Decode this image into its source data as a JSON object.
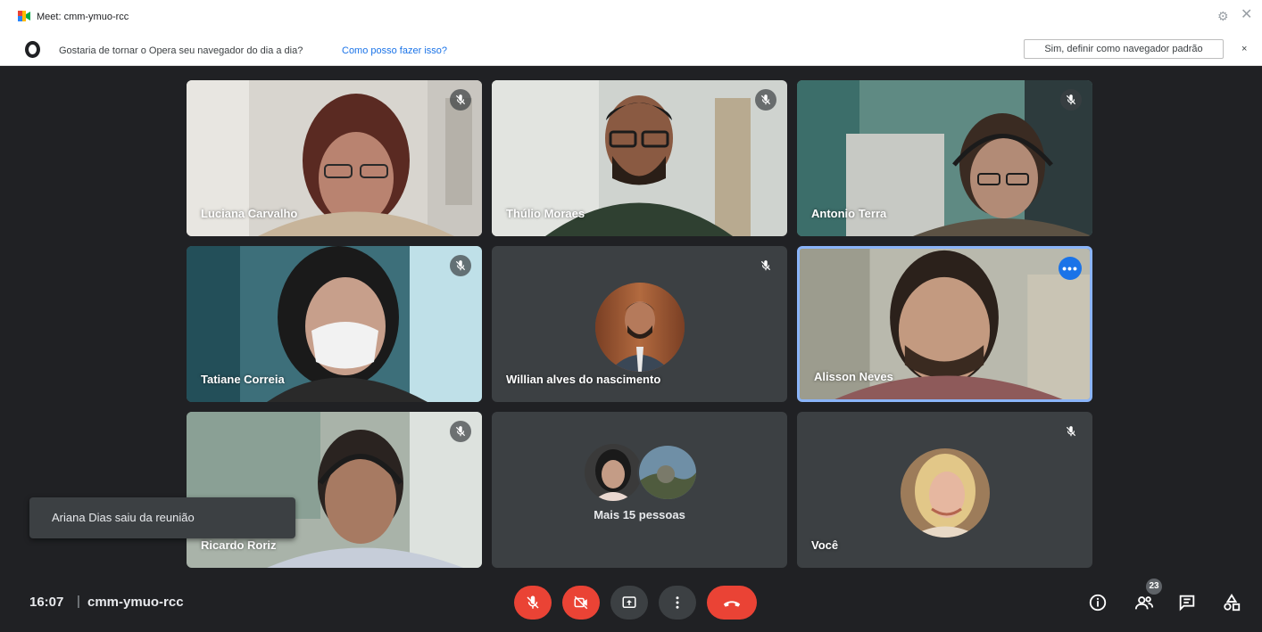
{
  "window": {
    "title": "Meet: cmm-ymuo-rcc"
  },
  "opera_bar": {
    "question": "Gostaria de tornar o Opera seu navegador do dia a dia?",
    "link": "Como posso fazer isso?",
    "button": "Sim, definir como navegador padrão",
    "close": "×"
  },
  "participants": [
    {
      "name": "Luciana Carvalho",
      "muted": true
    },
    {
      "name": "Thúlio Moraes",
      "muted": true
    },
    {
      "name": "Antonio Terra",
      "muted": true
    },
    {
      "name": "Tatiane Correia",
      "muted": true
    },
    {
      "name": "Willian alves do nascimento",
      "muted": true
    },
    {
      "name": "Alisson Neves",
      "muted": false,
      "speaking": true
    },
    {
      "name": "Ricardo Roriz",
      "muted": true
    },
    {
      "name": "Mais 15 pessoas"
    },
    {
      "name": "Você",
      "muted": true
    }
  ],
  "toast": {
    "message": "Ariana Dias saiu da reunião"
  },
  "bottom": {
    "time": "16:07",
    "separator": "|",
    "meeting_code": "cmm-ymuo-rcc",
    "people_count": "23"
  },
  "colors": {
    "background": "#202124",
    "tile": "#3c4043",
    "red": "#ea4335",
    "accent": "#1a73e8",
    "highlight": "#8ab4f8"
  },
  "icons": [
    "meet-logo-icon",
    "settings-icon",
    "close-icon",
    "opera-logo-icon",
    "mic-off-icon",
    "camera-off-icon",
    "present-icon",
    "more-options-icon",
    "end-call-icon",
    "info-icon",
    "people-icon",
    "chat-icon",
    "activities-icon"
  ]
}
